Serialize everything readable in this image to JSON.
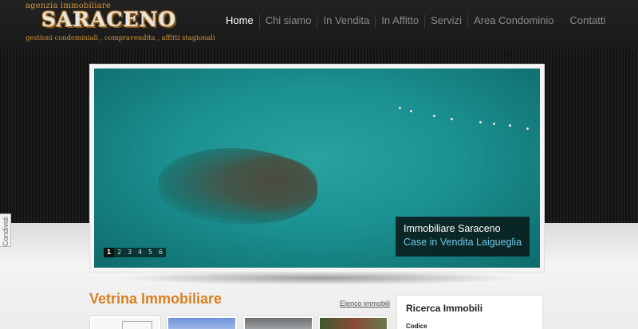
{
  "logo": {
    "tagline_top": "agenzia immobiliare",
    "brand": "SARACENO",
    "tagline_bottom": "gestioni condominiali , compravendita , affitti stagionali"
  },
  "nav": {
    "items": [
      "Home",
      "Chi siamo",
      "In Vendita",
      "In Affitto",
      "Servizi",
      "Area Condominio",
      "Contatti"
    ]
  },
  "slider": {
    "caption_title": "Immobiliare Saraceno",
    "caption_subtitle": "Case in Vendita Laigueglia",
    "pages": [
      "1",
      "2",
      "3",
      "4",
      "5",
      "6"
    ],
    "active_page": "1"
  },
  "share": {
    "label": "Condividi"
  },
  "showcase": {
    "title": "Vetrina Immobiliare",
    "list_link": "Elenco immobili",
    "list_link_arrow": "›"
  },
  "search": {
    "title": "Ricerca Immobili",
    "code_label": "Codice"
  },
  "colors": {
    "accent": "#d9801f",
    "caption_link": "#6ec9e8",
    "header_bg": "#1a1a1a"
  }
}
